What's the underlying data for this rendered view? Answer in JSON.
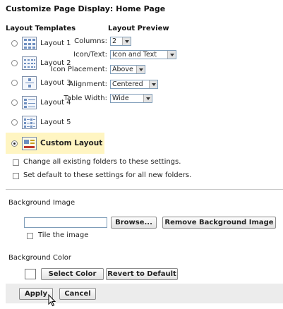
{
  "page_title": "Customize Page Display: Home Page",
  "templates": {
    "header": "Layout Templates",
    "items": [
      {
        "label": "Layout 1",
        "selected": false
      },
      {
        "label": "Layout 2",
        "selected": false
      },
      {
        "label": "Layout 3",
        "selected": false
      },
      {
        "label": "Layout 4",
        "selected": false
      },
      {
        "label": "Layout 5",
        "selected": false
      },
      {
        "label": "Custom Layout",
        "selected": true
      }
    ]
  },
  "preview": {
    "header": "Layout Preview",
    "columns_label": "Columns:",
    "columns_value": "2",
    "icon_text_label": "Icon/Text:",
    "icon_text_value": "Icon and Text",
    "icon_placement_label": "Icon Placement:",
    "icon_placement_value": "Above",
    "alignment_label": "Alignment:",
    "alignment_value": "Centered",
    "table_width_label": "Table Width:",
    "table_width_value": "Wide"
  },
  "options": {
    "change_existing": "Change all existing folders to these settings.",
    "set_default": "Set default to these settings for all new folders."
  },
  "background_image": {
    "header": "Background Image",
    "file_value": "",
    "browse_label": "Browse...",
    "remove_label": "Remove Background Image",
    "tile_label": "Tile the image"
  },
  "background_color": {
    "header": "Background Color",
    "select_label": "Select Color",
    "revert_label": "Revert to Default"
  },
  "actions": {
    "apply_label": "Apply",
    "cancel_label": "Cancel"
  }
}
